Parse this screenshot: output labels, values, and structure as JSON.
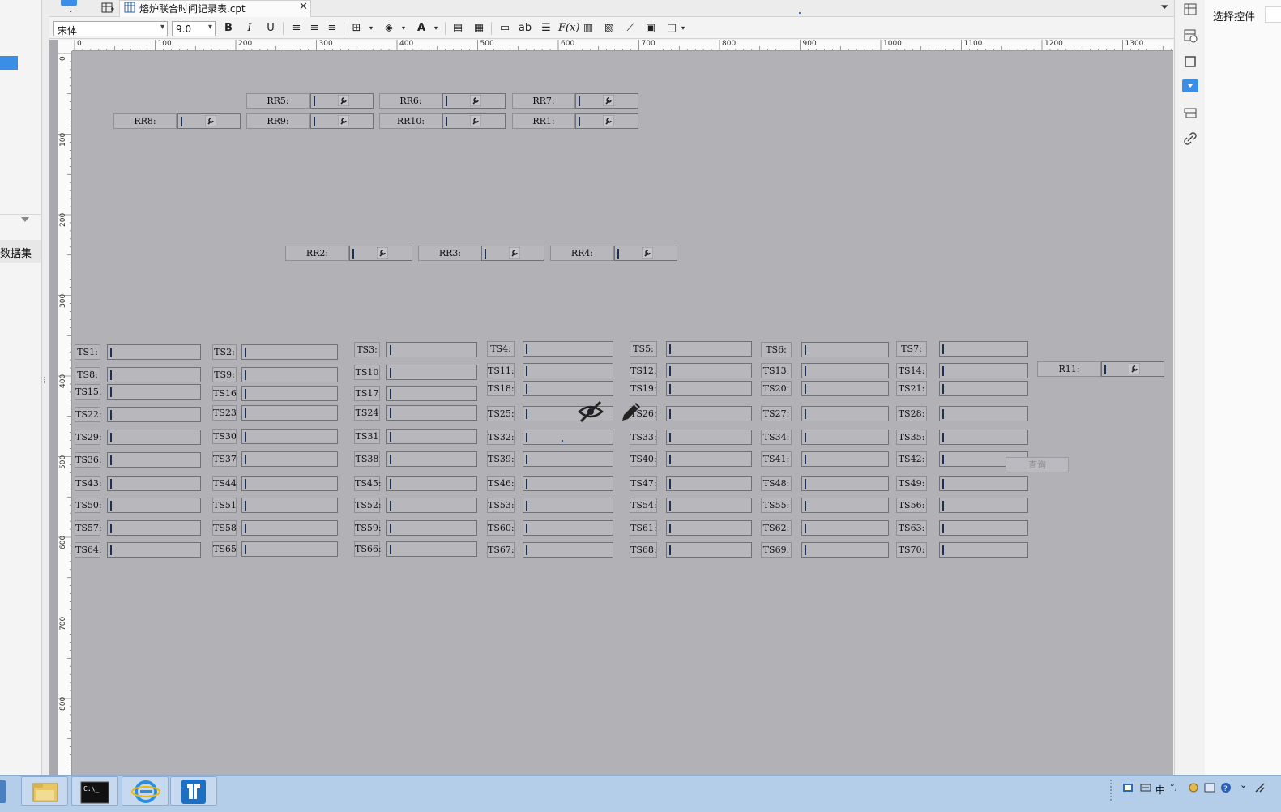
{
  "tab": {
    "file_label": "熔炉联合时间记录表.cpt",
    "close": "✕"
  },
  "toolbar": {
    "font_name": "宋体",
    "font_size": "9.0",
    "bold": "B",
    "italic": "I",
    "underline": "U",
    "ab": "ab",
    "fx": "F(x)"
  },
  "left_panel": {
    "dataset_label": "数据集"
  },
  "right_panel": {
    "title": "选择控件"
  },
  "ruler": {
    "top": [
      "0",
      "100",
      "200",
      "300",
      "400",
      "500",
      "600",
      "700",
      "800",
      "900",
      "1000",
      "1100",
      "1200",
      "1300"
    ],
    "left": [
      "0",
      "100",
      "200",
      "300",
      "400",
      "500",
      "600",
      "700",
      "800"
    ]
  },
  "form": {
    "tree_fields": [
      {
        "label": "RR5:"
      },
      {
        "label": "RR6:"
      },
      {
        "label": "RR7:"
      },
      {
        "label": "RR8:"
      },
      {
        "label": "RR9:"
      },
      {
        "label": "RR10:"
      },
      {
        "label": "RR1:"
      },
      {
        "label": "RR2:"
      },
      {
        "label": "RR3:"
      },
      {
        "label": "RR4:"
      },
      {
        "label": "R11:"
      }
    ],
    "ts_labels": [
      "TS1:",
      "TS2:",
      "TS3:",
      "TS4:",
      "TS5:",
      "TS6:",
      "TS7:",
      "TS8:",
      "TS9:",
      "TS10",
      "TS11:",
      "TS12:",
      "TS13:",
      "TS14:",
      "TS15:",
      "TS16",
      "TS17",
      "TS18:",
      "TS19:",
      "TS20:",
      "TS21:",
      "TS22:",
      "TS23",
      "TS24",
      "TS25:",
      "TS26:",
      "TS27:",
      "TS28:",
      "TS29:",
      "TS30",
      "TS31",
      "TS32:",
      "TS33:",
      "TS34:",
      "TS35:",
      "TS36:",
      "TS37",
      "TS38",
      "TS39:",
      "TS40:",
      "TS41:",
      "TS42:",
      "TS43:",
      "TS44",
      "TS45:",
      "TS46:",
      "TS47:",
      "TS48:",
      "TS49:",
      "TS50:",
      "TS51",
      "TS52:",
      "TS53:",
      "TS54:",
      "TS55:",
      "TS56:",
      "TS57:",
      "TS58",
      "TS59:",
      "TS60:",
      "TS61:",
      "TS62:",
      "TS63:",
      "TS64:",
      "TS65",
      "TS66:",
      "TS67:",
      "TS68:",
      "TS69:",
      "TS70:"
    ],
    "query_button": "查询"
  },
  "taskbar": {
    "tray_lang": "中"
  },
  "colors": {
    "canvas": "#b2b1b6",
    "accent": "#3a8ee6",
    "caret": "#1d2e57"
  }
}
